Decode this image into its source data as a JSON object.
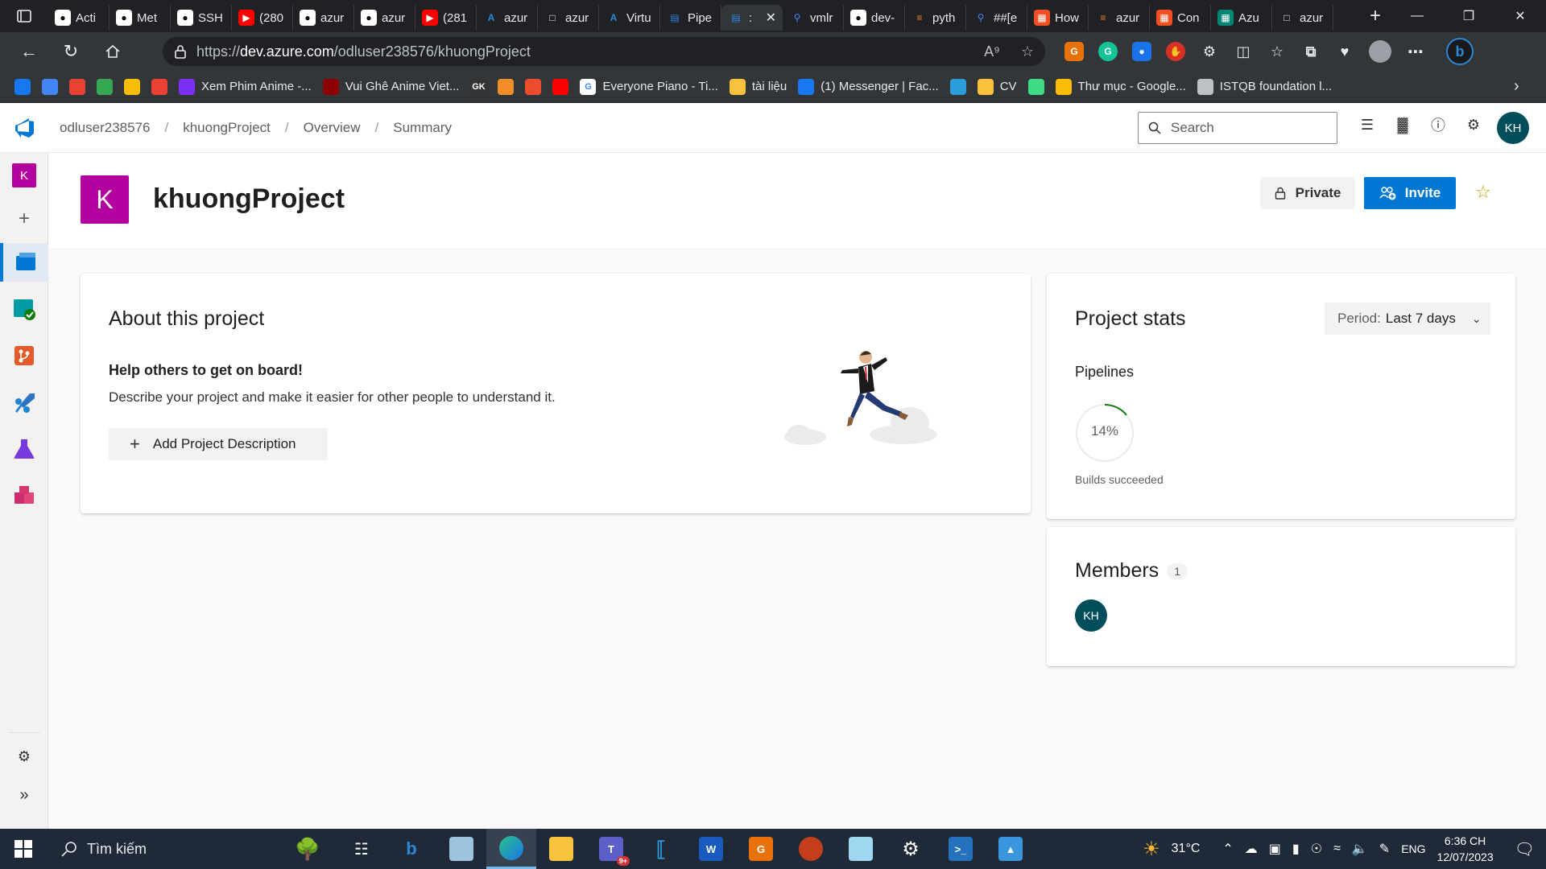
{
  "browser": {
    "tabs": [
      {
        "label": "Acti",
        "icon": "github"
      },
      {
        "label": "Met",
        "icon": "github"
      },
      {
        "label": "SSH",
        "icon": "github"
      },
      {
        "label": "(280",
        "icon": "youtube"
      },
      {
        "label": "azur",
        "icon": "github"
      },
      {
        "label": "azur",
        "icon": "github"
      },
      {
        "label": "(281",
        "icon": "youtube"
      },
      {
        "label": "azur",
        "icon": "azure"
      },
      {
        "label": "azur",
        "icon": "document"
      },
      {
        "label": "Virtu",
        "icon": "azure"
      },
      {
        "label": "Pipe",
        "icon": "azure-devops"
      },
      {
        "label": ":",
        "icon": "azure-devops",
        "active": true
      },
      {
        "label": "vmlr",
        "icon": "search"
      },
      {
        "label": "dev-",
        "icon": "github"
      },
      {
        "label": "pyth",
        "icon": "stackoverflow"
      },
      {
        "label": "##[e",
        "icon": "search"
      },
      {
        "label": "How",
        "icon": "microsoft"
      },
      {
        "label": "azur",
        "icon": "stackoverflow"
      },
      {
        "label": "Con",
        "icon": "microsoft"
      },
      {
        "label": "Azu",
        "icon": "azure-learn"
      },
      {
        "label": "azur",
        "icon": "document"
      }
    ],
    "url_prefix": "https://",
    "url_host": "dev.azure.com",
    "url_path": "/odluser238576/khuongProject",
    "bookmarks": [
      {
        "label": "",
        "icon": "facebook",
        "color": "#1877f2"
      },
      {
        "label": "",
        "icon": "translate",
        "color": "#4285f4"
      },
      {
        "label": "",
        "icon": "pinwheel",
        "color": "#e94235"
      },
      {
        "label": "",
        "icon": "maps",
        "color": "#34a853"
      },
      {
        "label": "",
        "icon": "drive",
        "color": "#fbbc04"
      },
      {
        "label": "",
        "icon": "gmail",
        "color": "#ea4335"
      },
      {
        "label": "Xem Phim Anime -...",
        "icon": "play",
        "color": "#7b2ff7"
      },
      {
        "label": "Vui Ghê Anime Viet...",
        "icon": "play-dark",
        "color": "#8b0000"
      },
      {
        "label": "",
        "icon": "gk",
        "color": "#333333"
      },
      {
        "label": "",
        "icon": "gear-orange",
        "color": "#f28c28"
      },
      {
        "label": "",
        "icon": "shopee",
        "color": "#ee4d2d"
      },
      {
        "label": "",
        "icon": "youtube",
        "color": "#ff0000"
      },
      {
        "label": "Everyone Piano - Ti...",
        "icon": "google",
        "color": "#ffffff"
      },
      {
        "label": "tài liệu",
        "icon": "folder",
        "color": "#f9c23c"
      },
      {
        "label": "(1) Messenger | Fac...",
        "icon": "facebook",
        "color": "#1877f2"
      },
      {
        "label": "",
        "icon": "camera",
        "color": "#2d9cdb"
      },
      {
        "label": "CV",
        "icon": "folder",
        "color": "#f9c23c"
      },
      {
        "label": "",
        "icon": "android",
        "color": "#3ddc84"
      },
      {
        "label": "Thư mục - Google...",
        "icon": "drive",
        "color": "#fbbc04"
      },
      {
        "label": "ISTQB foundation l...",
        "icon": "document",
        "color": "#bdc1c6"
      }
    ]
  },
  "ado": {
    "breadcrumb": [
      "odluser238576",
      "khuongProject",
      "Overview",
      "Summary"
    ],
    "search_placeholder": "Search",
    "user_initials": "KH",
    "project_initial": "K",
    "project_name": "khuongProject",
    "private_label": "Private",
    "invite_label": "Invite",
    "about": {
      "title": "About this project",
      "help_title": "Help others to get on board!",
      "help_desc": "Describe your project and make it easier for other people to understand it.",
      "add_button": "Add Project Description"
    },
    "stats": {
      "title": "Project stats",
      "period_label": "Period:",
      "period_value": "Last 7 days",
      "pipelines_label": "Pipelines",
      "builds_percent": "14%",
      "builds_fraction": 0.14,
      "builds_label": "Builds succeeded"
    },
    "members": {
      "title": "Members",
      "count": "1",
      "list": [
        "KH"
      ]
    },
    "colors": {
      "accent": "#0078d4",
      "project": "#b4009e",
      "avatar": "#004e5c",
      "success": "#107c10"
    }
  },
  "taskbar": {
    "search_placeholder": "Tìm kiếm",
    "weather": "31°C",
    "language": "ENG",
    "time": "6:36 CH",
    "date": "12/07/2023",
    "teams_badge": "9+"
  }
}
